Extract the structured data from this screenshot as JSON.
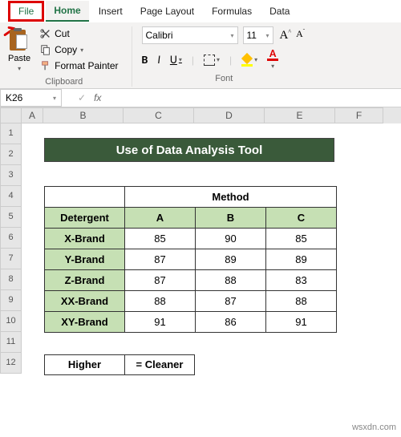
{
  "tabs": {
    "file": "File",
    "home": "Home",
    "insert": "Insert",
    "pagelayout": "Page Layout",
    "formulas": "Formulas",
    "data": "Data"
  },
  "clipboard": {
    "paste": "Paste",
    "cut": "Cut",
    "copy": "Copy",
    "painter": "Format Painter",
    "group": "Clipboard"
  },
  "font": {
    "name": "Calibri",
    "size": "11",
    "group": "Font",
    "bold": "B",
    "italic": "I",
    "underline": "U",
    "color_letter": "A"
  },
  "namebox": "K26",
  "fx": "fx",
  "cols": [
    "A",
    "B",
    "C",
    "D",
    "E",
    "F"
  ],
  "rows": [
    "1",
    "2",
    "3",
    "4",
    "5",
    "6",
    "7",
    "8",
    "9",
    "10",
    "11",
    "12"
  ],
  "title": "Use of Data Analysis Tool",
  "headers": {
    "method": "Method",
    "detergent": "Detergent",
    "a": "A",
    "b": "B",
    "c": "C"
  },
  "brands": {
    "r1": {
      "name": "X-Brand",
      "a": "85",
      "b": "90",
      "c": "85"
    },
    "r2": {
      "name": "Y-Brand",
      "a": "87",
      "b": "89",
      "c": "89"
    },
    "r3": {
      "name": "Z-Brand",
      "a": "87",
      "b": "88",
      "c": "83"
    },
    "r4": {
      "name": "XX-Brand",
      "a": "88",
      "b": "87",
      "c": "88"
    },
    "r5": {
      "name": "XY-Brand",
      "a": "91",
      "b": "86",
      "c": "91"
    }
  },
  "legend": {
    "higher": "Higher",
    "cleaner": "= Cleaner"
  },
  "watermark": "wsxdn.com",
  "chart_data": {
    "type": "table",
    "title": "Use of Data Analysis Tool",
    "row_label": "Detergent",
    "col_label": "Method",
    "columns": [
      "A",
      "B",
      "C"
    ],
    "rows": [
      "X-Brand",
      "Y-Brand",
      "Z-Brand",
      "XX-Brand",
      "XY-Brand"
    ],
    "values": [
      [
        85,
        90,
        85
      ],
      [
        87,
        89,
        89
      ],
      [
        87,
        88,
        83
      ],
      [
        88,
        87,
        88
      ],
      [
        91,
        86,
        91
      ]
    ],
    "note": "Higher = Cleaner"
  }
}
